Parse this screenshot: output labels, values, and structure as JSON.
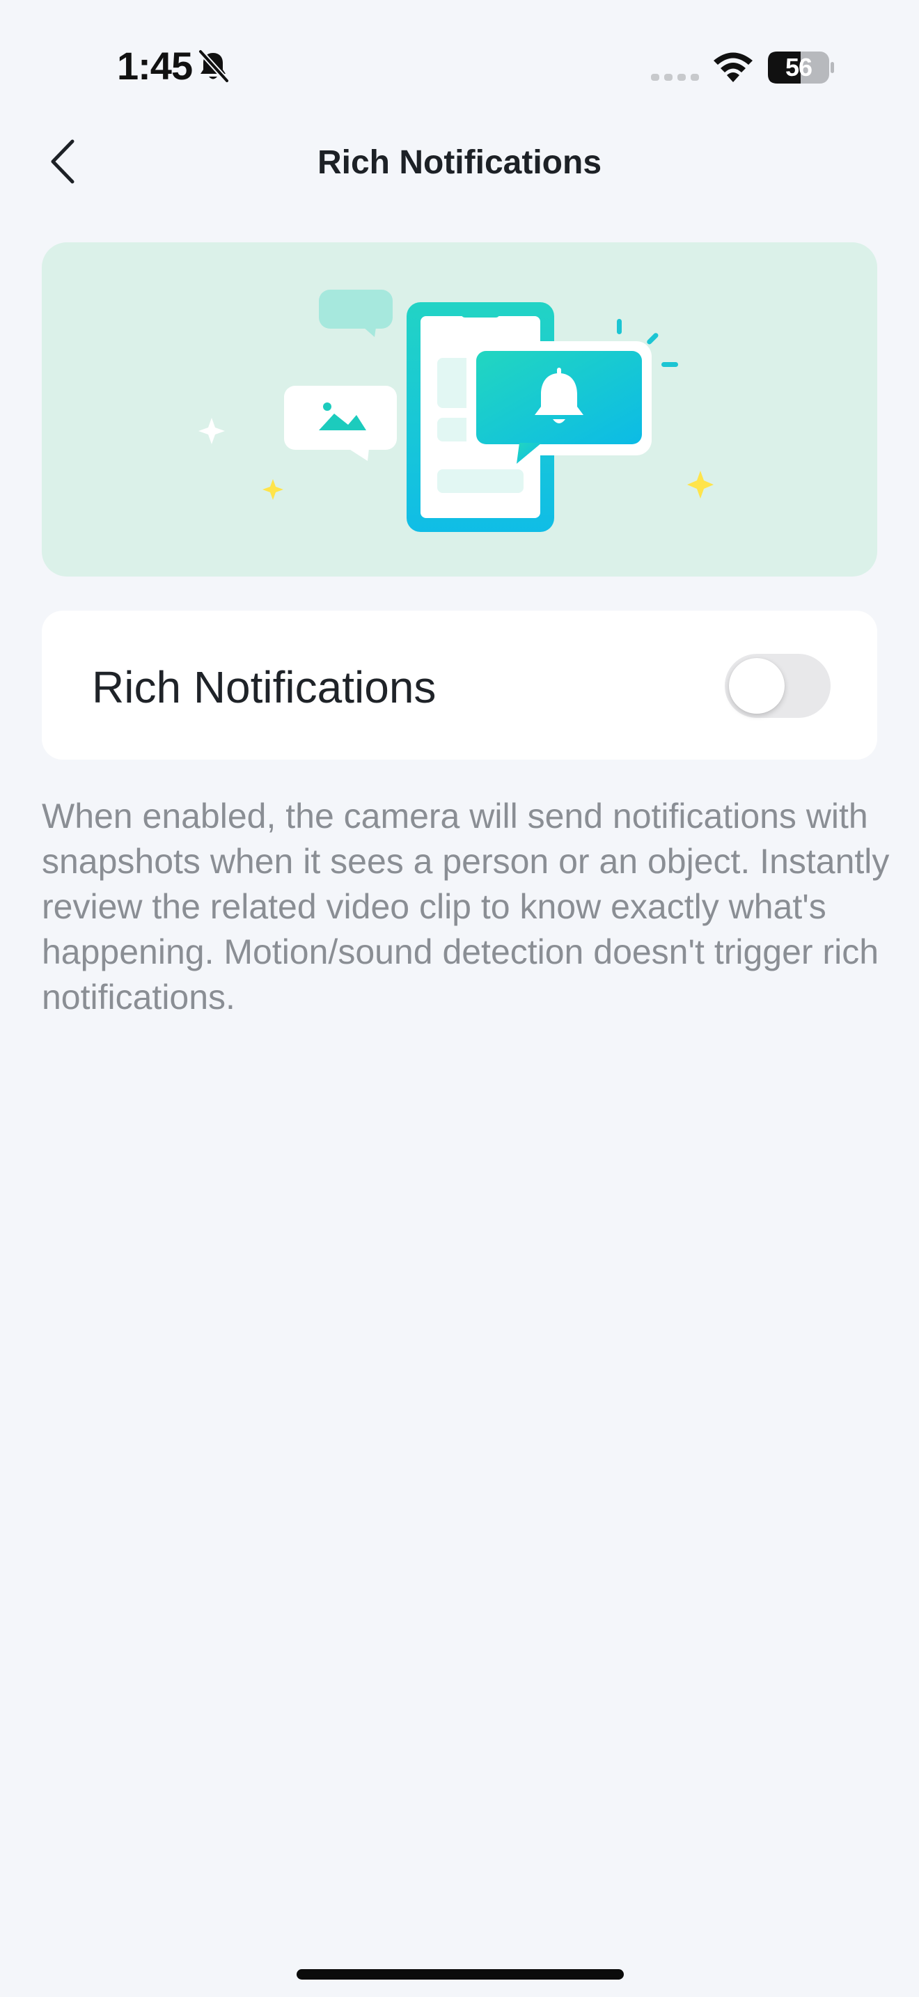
{
  "status_bar": {
    "time": "1:45",
    "battery": "56"
  },
  "header": {
    "title": "Rich Notifications"
  },
  "setting": {
    "label": "Rich Notifications",
    "enabled": false
  },
  "description": "When enabled, the camera will send notifications with snapshots when it sees a person or an object. Instantly review the related video clip to know exactly what's happening. Motion/sound detection doesn't trigger rich notifications.",
  "icons": {
    "back": "chevron-left-icon",
    "bell_off": "bell-slash-icon",
    "wifi": "wifi-icon",
    "battery": "battery-icon",
    "signal": "cellular-signal-icon"
  },
  "colors": {
    "background": "#f4f6fa",
    "hero_background": "#dbf1e9",
    "accent_teal": "#1ccbbd",
    "toggle_off": "#e8e8ea",
    "description_text": "#8a8e94"
  }
}
